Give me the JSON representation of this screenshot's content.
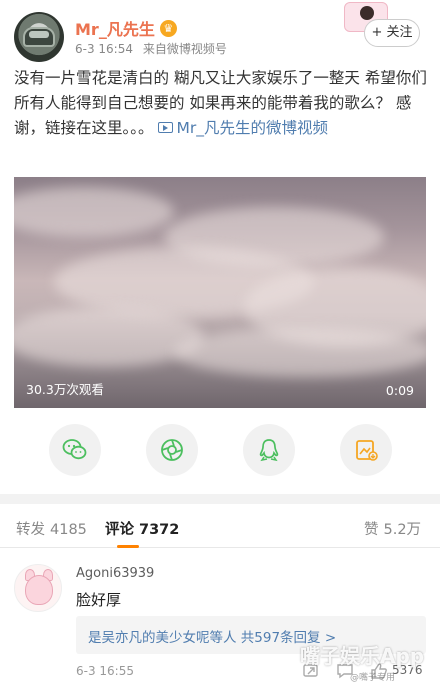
{
  "post": {
    "username": "Mr_凡先生",
    "time": "6-3 16:54",
    "source": "来自微博视频号",
    "follow_label": "+ 关注",
    "text_main": "没有一片雪花是清白的 糊凡又让大家娱乐了一整天 希望你们所有人能得到自己想要的 如果再来的能带着我的歌么？ 感谢，链接在这里。。。",
    "video_link_text": "Mr_凡先生的微博视频"
  },
  "video": {
    "views": "30.3万次观看",
    "duration": "0:09"
  },
  "share": {
    "icons": [
      "wechat-icon",
      "moments-icon",
      "qq-icon",
      "share-to-story-icon"
    ],
    "colors": {
      "icon_green": "#4cbf5f",
      "icon_orange": "#f5a623"
    }
  },
  "stats": {
    "repost_label": "转发",
    "repost_count": "4185",
    "comment_label": "评论",
    "comment_count": "7372",
    "like_label": "赞",
    "like_count": "5.2万"
  },
  "comment": {
    "username": "Agoni63939",
    "text": "脸好厚",
    "reply_summary": "是吴亦凡的美少女呢等人  共597条回复 >",
    "time": "6-3 16:55",
    "likes": "5376"
  },
  "watermark": {
    "text": "嘴子娱乐App",
    "sub": "@嘴子专用"
  },
  "colors": {
    "username": "#eb7350",
    "link": "#507daf",
    "tab_underline": "#ff8200"
  }
}
